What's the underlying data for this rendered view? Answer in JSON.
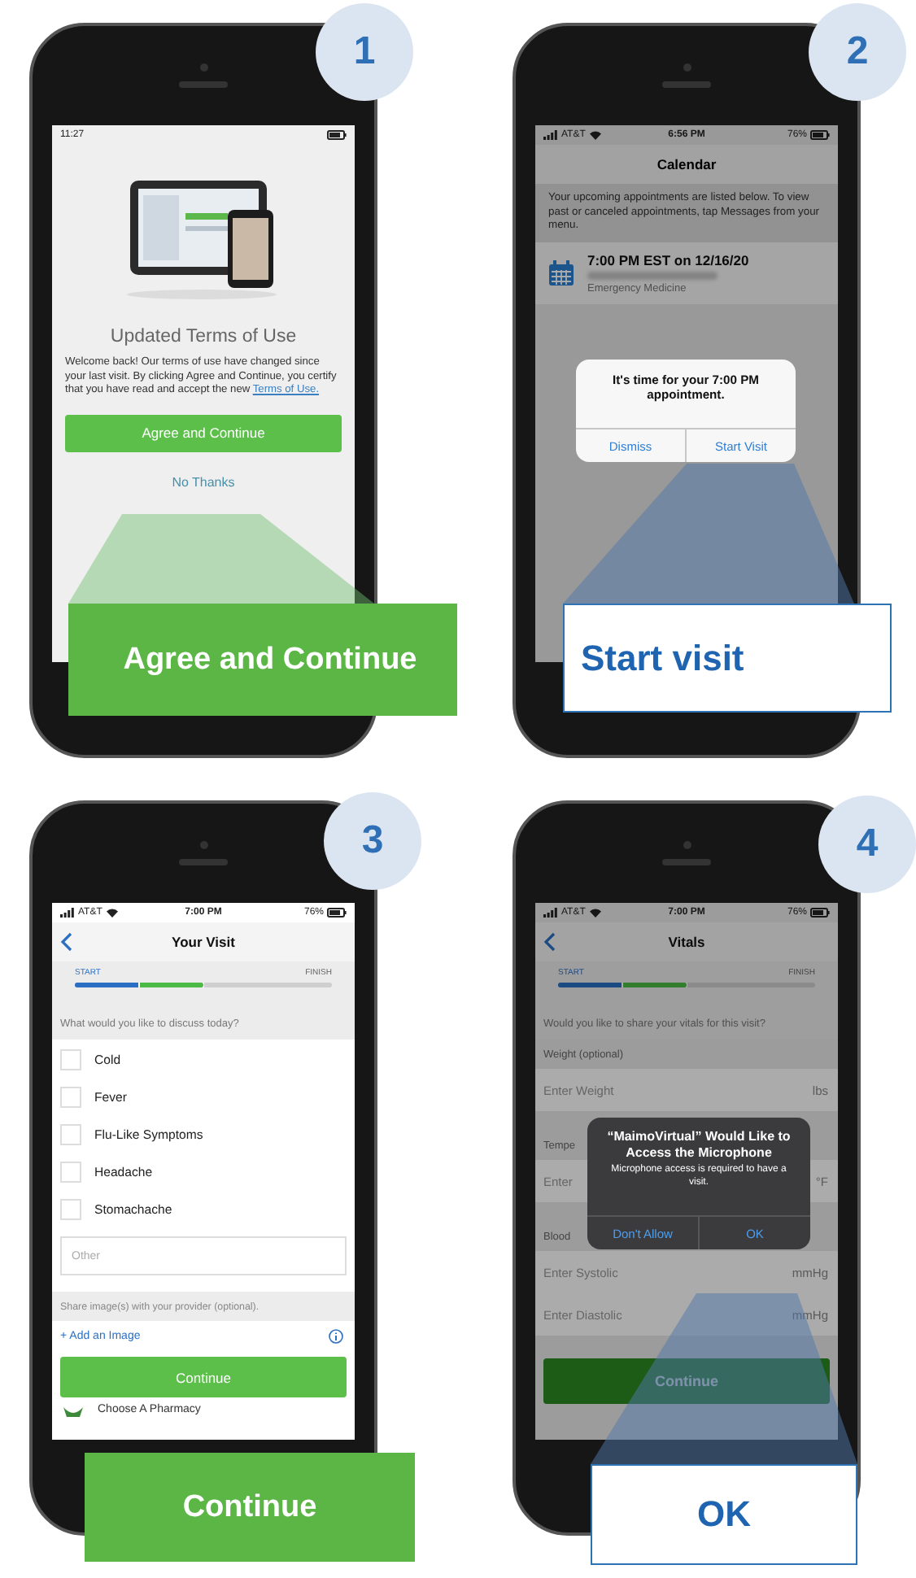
{
  "panels": [
    {
      "number": "1",
      "dimmed": false,
      "callout": {
        "text": "Agree and Continue"
      },
      "screen": {
        "kind": "terms",
        "status_bar": {
          "time": "11:27"
        },
        "title": "Updated Terms of Use",
        "body": "Welcome back! Our terms of use have changed since your last visit. By clicking Agree and Continue, you certify that you have read and accept the new",
        "link": "Terms of Use.",
        "button": "Agree and Continue",
        "secondary_link": "No Thanks"
      }
    },
    {
      "number": "2",
      "dimmed": true,
      "callout": {
        "text": "Start visit"
      },
      "screen": {
        "kind": "calendar",
        "status_bar": {
          "carrier": "AT&T",
          "time": "6:56 PM",
          "battery": "76%"
        },
        "title": "Calendar",
        "notice": "Your upcoming appointments are listed below. To view past or canceled appointments, tap Messages from your menu.",
        "appointment": {
          "time": "7:00 PM EST on 12/16/20",
          "department": "Emergency Medicine"
        },
        "alert": {
          "message": "It's time for your 7:00 PM appointment.",
          "buttons": [
            "Dismiss",
            "Start Visit"
          ]
        }
      }
    },
    {
      "number": "3",
      "dimmed": false,
      "callout": {
        "text": "Continue"
      },
      "screen": {
        "kind": "visit_form",
        "status_bar": {
          "carrier": "AT&T",
          "time": "7:00 PM",
          "battery": "76%"
        },
        "title": "Your Visit",
        "progress": {
          "start": "START",
          "finish": "FINISH",
          "level": 0.5
        },
        "question": "What would you like to discuss today?",
        "options": [
          {
            "label": "Cold",
            "checked": false
          },
          {
            "label": "Fever",
            "checked": false
          },
          {
            "label": "Flu-Like Symptoms",
            "checked": false
          },
          {
            "label": "Headache",
            "checked": false
          },
          {
            "label": "Stomachache",
            "checked": false
          }
        ],
        "other_placeholder": "Other",
        "share_label": "Share image(s) with your provider (optional).",
        "add_image": "+ Add an Image",
        "button": "Continue",
        "next_row": "Choose A Pharmacy"
      }
    },
    {
      "number": "4",
      "dimmed": true,
      "callout": {
        "text": "OK"
      },
      "screen": {
        "kind": "vitals",
        "status_bar": {
          "carrier": "AT&T",
          "time": "7:00 PM",
          "battery": "76%"
        },
        "title": "Vitals",
        "progress": {
          "start": "START",
          "finish": "FINISH",
          "level": 0.5
        },
        "question": "Would you like to share your vitals for this visit?",
        "rows": [
          {
            "kind": "label",
            "text": "Weight (optional)"
          },
          {
            "kind": "field",
            "placeholder": "Enter Weight",
            "unit": "lbs"
          },
          {
            "kind": "label",
            "text": "Tempe"
          },
          {
            "kind": "field",
            "placeholder": "Enter",
            "unit": "°F"
          },
          {
            "kind": "label",
            "text": "Blood"
          },
          {
            "kind": "field",
            "placeholder": "Enter Systolic",
            "unit": "mmHg"
          },
          {
            "kind": "field",
            "placeholder": "Enter Diastolic",
            "unit": "mmHg"
          }
        ],
        "button": "Continue",
        "alert": {
          "title": "“MaimoVirtual” Would Like to Access the Microphone",
          "message": "Microphone access is required to have a visit.",
          "buttons": [
            "Don't Allow",
            "OK"
          ]
        }
      }
    }
  ]
}
